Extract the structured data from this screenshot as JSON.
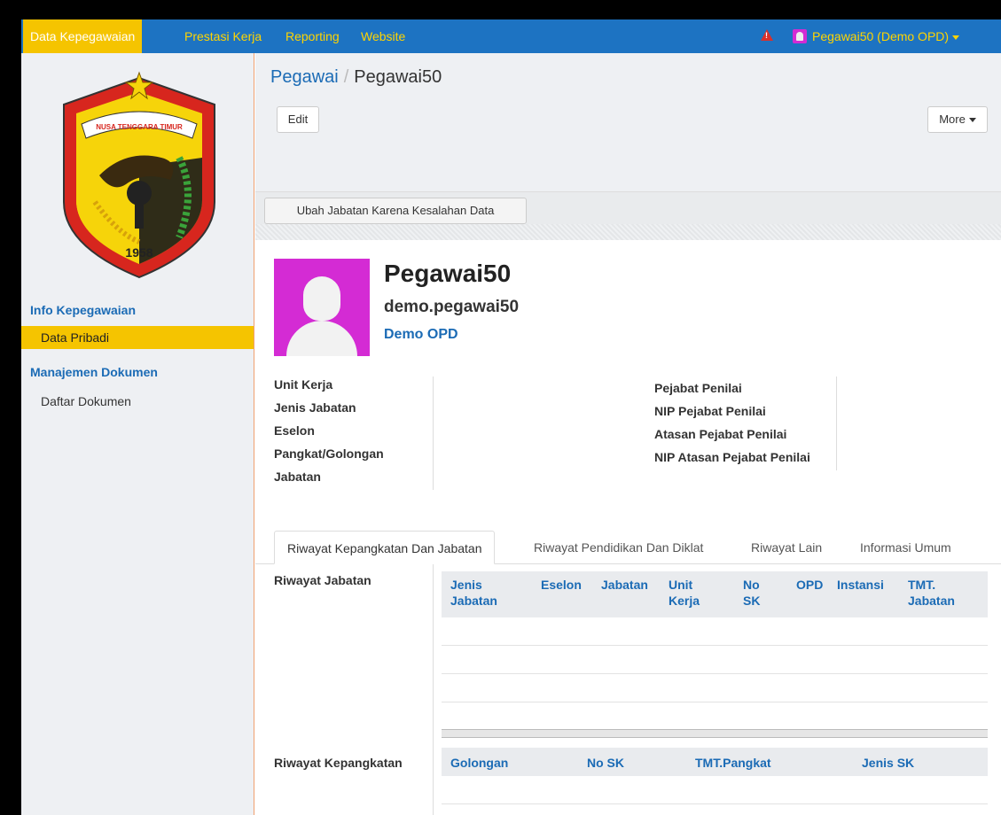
{
  "topbar": {
    "nav": [
      "Data Kepegawaian",
      "Prestasi Kerja",
      "Reporting",
      "Website"
    ],
    "user": "Pegawai50 (Demo OPD)"
  },
  "sidebar": {
    "logo_text": "NUSA TENGGARA TIMUR",
    "logo_year": "1958",
    "sections": [
      {
        "title": "Info Kepegawaian",
        "items": [
          "Data Pribadi"
        ]
      },
      {
        "title": "Manajemen Dokumen",
        "items": [
          "Daftar Dokumen"
        ]
      }
    ]
  },
  "breadcrumb": {
    "parent": "Pegawai",
    "current": "Pegawai50"
  },
  "buttons": {
    "edit": "Edit",
    "more": "More",
    "ubah": "Ubah Jabatan Karena Kesalahan Data"
  },
  "profile": {
    "name": "Pegawai50",
    "login": "demo.pegawai50",
    "opd": "Demo OPD"
  },
  "info_left": [
    "Unit Kerja",
    "Jenis Jabatan",
    "Eselon",
    "Pangkat/Golongan",
    "Jabatan"
  ],
  "info_right": [
    "Pejabat Penilai",
    "NIP Pejabat Penilai",
    "Atasan Pejabat Penilai",
    "NIP Atasan Pejabat Penilai"
  ],
  "tabs": [
    "Riwayat Kepangkatan Dan Jabatan",
    "Riwayat Pendidikan Dan Diklat",
    "Riwayat Lain",
    "Informasi Umum"
  ],
  "riwayat_jabatan": {
    "label": "Riwayat Jabatan",
    "columns": [
      "Jenis Jabatan",
      "Eselon",
      "Jabatan",
      "Unit Kerja",
      "No SK",
      "OPD",
      "Instansi",
      "TMT. Jabatan"
    ]
  },
  "riwayat_kepangkatan": {
    "label": "Riwayat Kepangkatan",
    "columns": [
      "Golongan",
      "No SK",
      "TMT.Pangkat",
      "Jenis SK"
    ]
  },
  "colors": {
    "topbar": "#1d73c2",
    "accent_yellow": "#f5c400",
    "link_blue": "#1b6bb5",
    "avatar": "#d42bd4"
  }
}
